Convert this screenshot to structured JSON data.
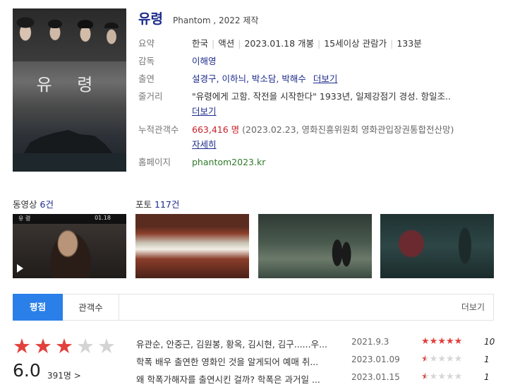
{
  "movie": {
    "title": "유령",
    "subtitle": "Phantom , 2022 제작",
    "poster_title": "유 령"
  },
  "info": {
    "summary_label": "요약",
    "summary_country": "한국",
    "summary_genre": "액션",
    "summary_release": "2023.01.18 개봉",
    "summary_rating": "15세이상 관람가",
    "summary_runtime": "133분",
    "director_label": "감독",
    "director": "이해영",
    "cast_label": "출연",
    "cast": "설경구, 이하늬, 박소담, 박해수",
    "cast_more": "더보기",
    "plot_label": "줄거리",
    "plot": "\"유령에게 고함. 작전을 시작한다\" 1933년, 일제강점기 경성. 항일조..",
    "plot_more": "더보기",
    "audience_label": "누적관객수",
    "audience_count": "663,416 명",
    "audience_source": "(2023.02.23, 영화진흥위원회 영화관입장권통합전산망)",
    "audience_more": "자세히",
    "homepage_label": "홈페이지",
    "homepage": "phantom2023.kr"
  },
  "media": {
    "video_label": "동영상",
    "video_count": "6건",
    "photo_label": "포토",
    "photo_count": "117건",
    "video_overlay_left": "유 령",
    "video_overlay_right": "01.18"
  },
  "tabs": {
    "rating": "평점",
    "audience": "관객수",
    "more": "더보기"
  },
  "rating": {
    "stars_filled": 3,
    "stars_total": 5,
    "score": "6.0",
    "votes": "391명 >"
  },
  "reviews": [
    {
      "text": "유관순, 안중근, 김원봉, 황옥, 김시현, 김구......우...",
      "date": "2021.9.3",
      "stars": 5,
      "score": "10"
    },
    {
      "text": "학폭 배우 출연한 영화인 것을 알게되어 예매 취...",
      "date": "2023.01.09",
      "stars": 0.5,
      "score": "1"
    },
    {
      "text": "왜 학폭가해자를 출연시킨 걸까? 학폭은 과거일 ...",
      "date": "2023.01.15",
      "stars": 0.5,
      "score": "1"
    }
  ],
  "colors": {
    "accent": "#2a7fe8",
    "link": "#1b2a8a",
    "star": "#e2403c",
    "audience": "#c8202a"
  }
}
